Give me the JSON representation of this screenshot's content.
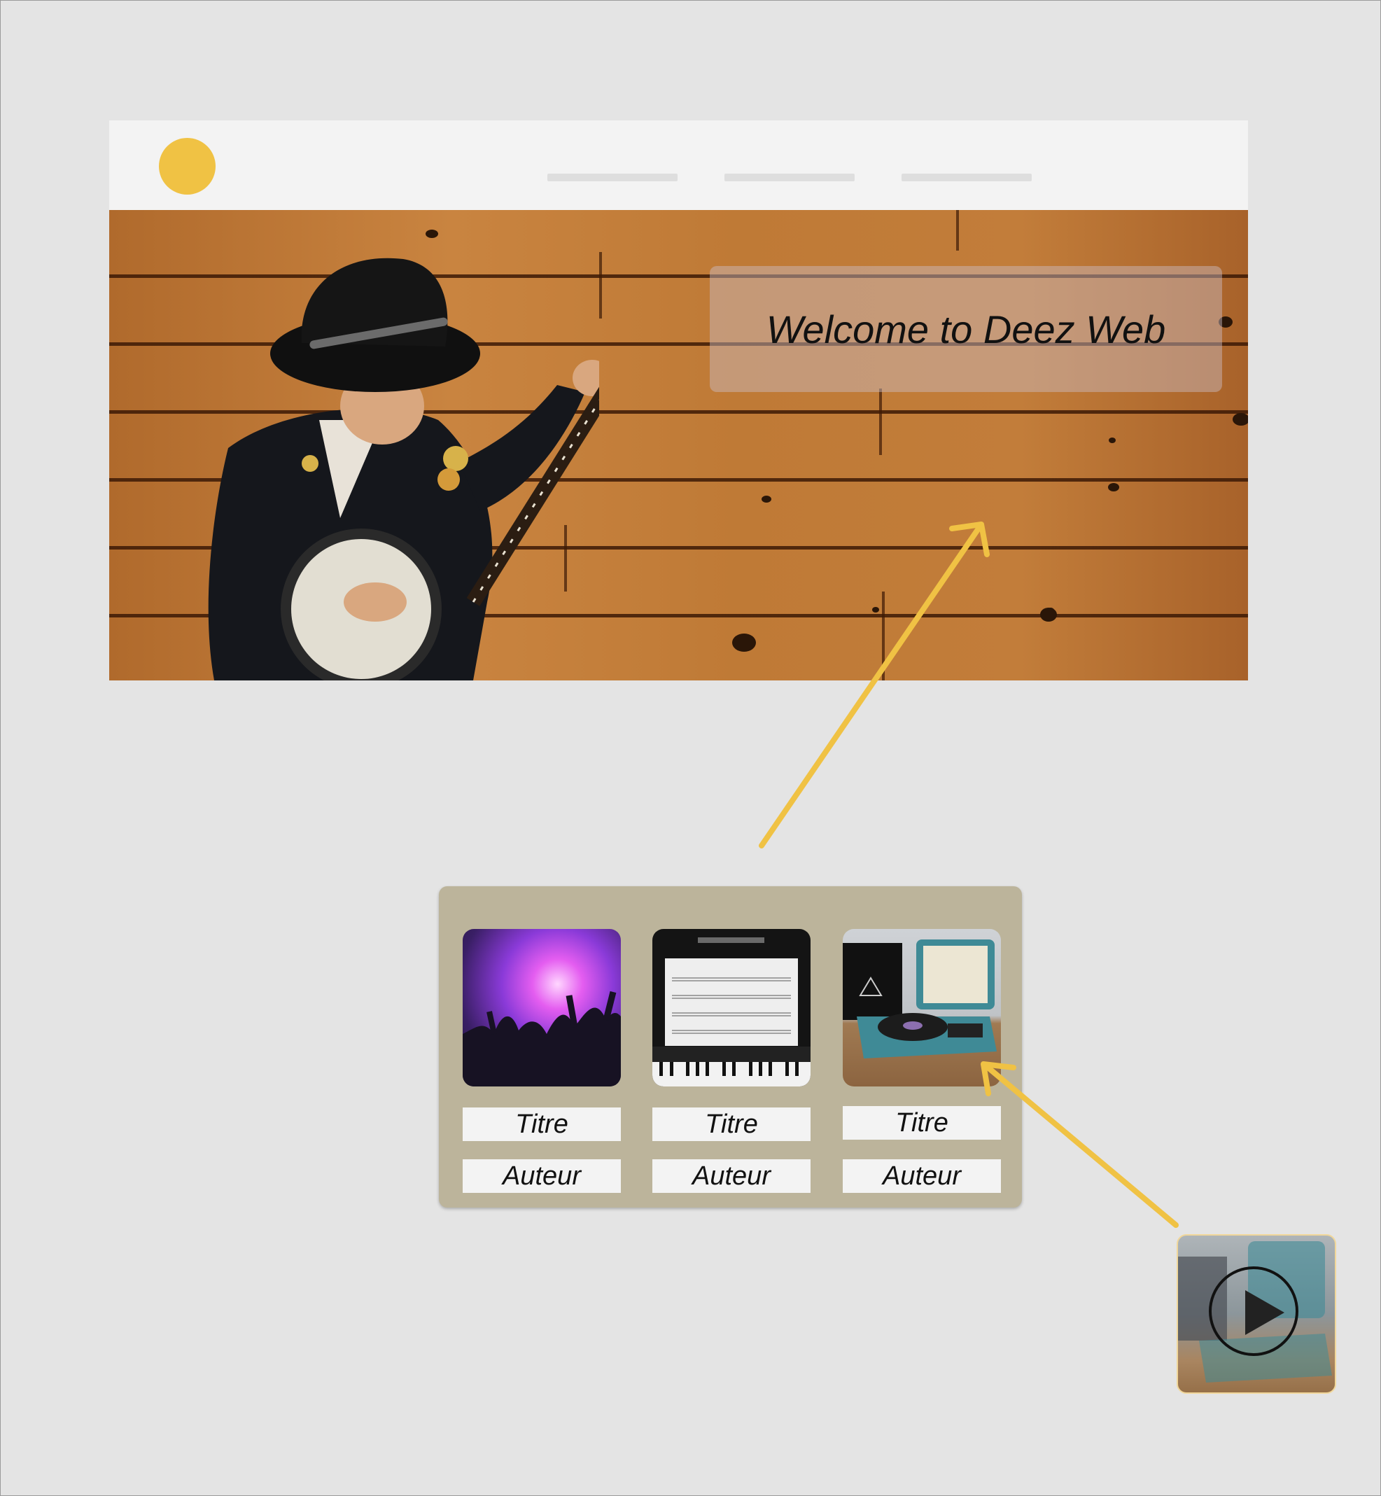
{
  "hero": {
    "welcome_text": "Welcome to Deez Web"
  },
  "cards": [
    {
      "title": "Titre",
      "author": "Auteur",
      "image": "concert-crowd-image"
    },
    {
      "title": "Titre",
      "author": "Auteur",
      "image": "sheet-music-piano-image"
    },
    {
      "title": "Titre",
      "author": "Auteur",
      "image": "record-player-image"
    }
  ],
  "player": {
    "icon": "play-icon"
  },
  "colors": {
    "accent": "#f0c244",
    "background": "#e4e4e4",
    "nav_background": "#f3f3f3",
    "cards_background": "#bcb49b"
  }
}
